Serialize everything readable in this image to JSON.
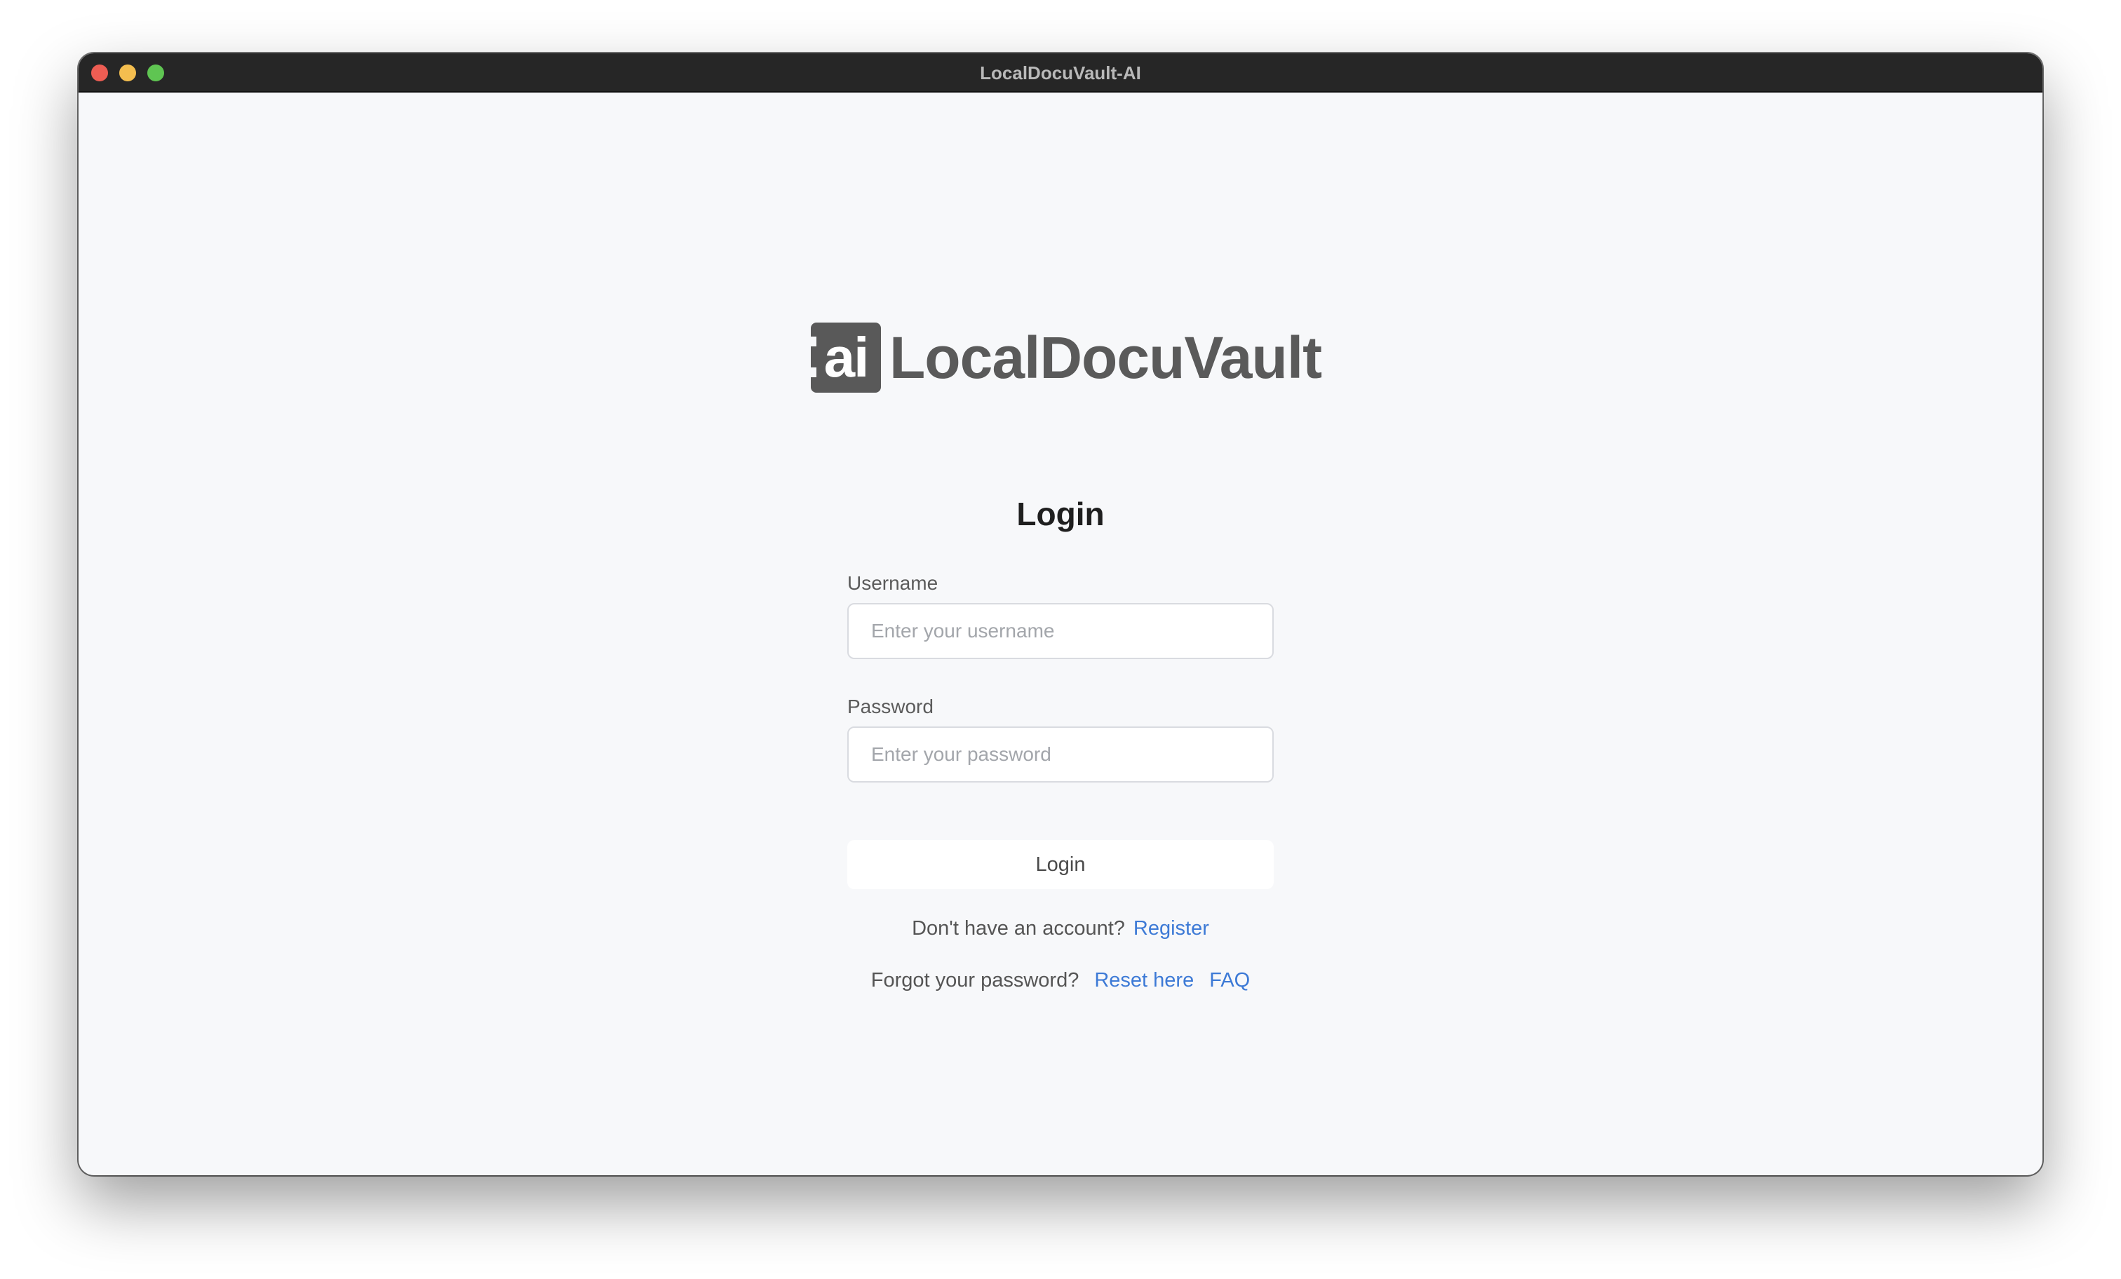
{
  "window": {
    "title": "LocalDocuVault-AI"
  },
  "logo": {
    "mark": "ai",
    "text": "LocalDocuVault"
  },
  "login": {
    "heading": "Login",
    "username_label": "Username",
    "username_placeholder": "Enter your username",
    "password_label": "Password",
    "password_placeholder": "Enter your password",
    "submit_label": "Login",
    "register_prompt": "Don't have an account?",
    "register_link": "Register",
    "forgot_prompt": "Forgot your password?",
    "reset_link": "Reset here",
    "faq_link": "FAQ"
  },
  "colors": {
    "link": "#3d7ad6",
    "logo": "#595959",
    "background": "#f7f8fa",
    "titlebar": "#262626"
  }
}
